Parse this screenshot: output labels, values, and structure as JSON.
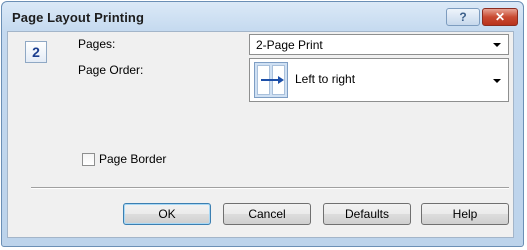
{
  "window": {
    "title": "Page Layout Printing",
    "help_glyph": "?",
    "close_glyph": "✕"
  },
  "pages": {
    "icon_number": "2",
    "label": "Pages:",
    "selected": "2-Page Print"
  },
  "page_order": {
    "label": "Page Order:",
    "selected": "Left to right",
    "icon": "left-to-right-order-icon"
  },
  "page_border": {
    "label": "Page Border",
    "checked": false
  },
  "buttons": {
    "ok": "OK",
    "cancel": "Cancel",
    "defaults": "Defaults",
    "help": "Help"
  }
}
